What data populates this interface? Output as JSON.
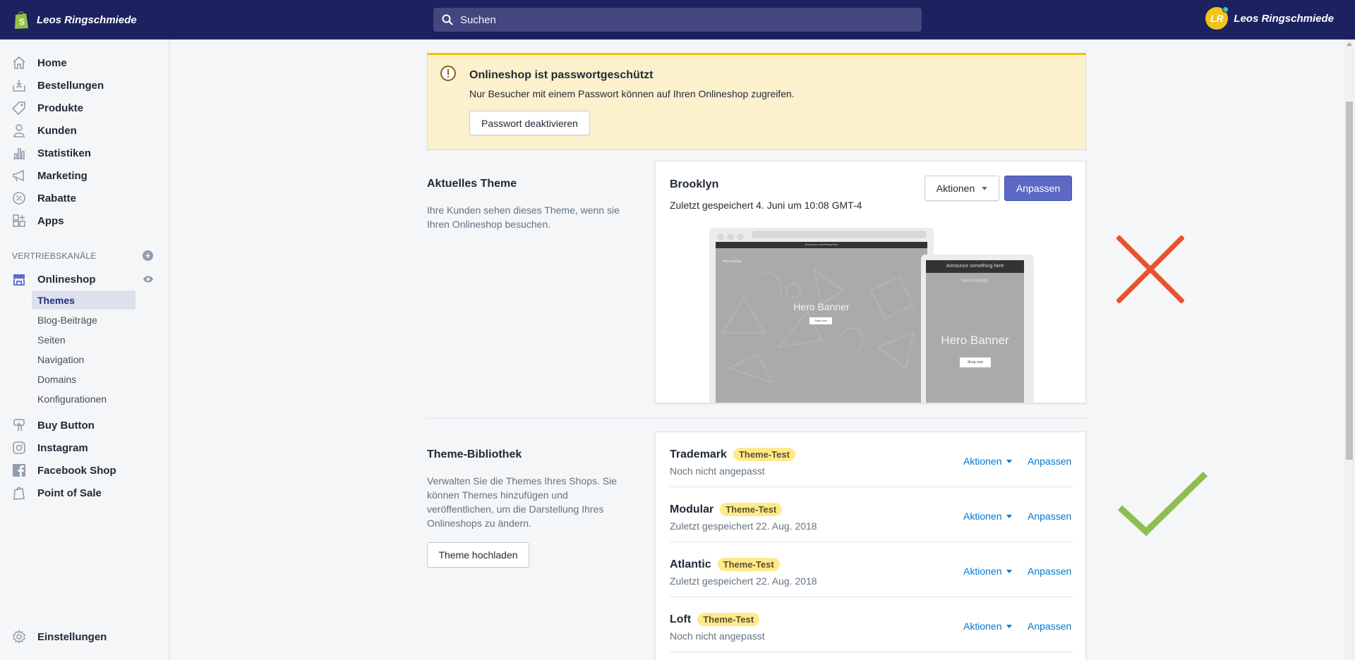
{
  "topbar": {
    "store_name": "Leos Ringschmiede",
    "search_placeholder": "Suchen",
    "avatar_initials": "LR",
    "account_name": "Leos Ringschmiede"
  },
  "sidebar": {
    "items": [
      {
        "label": "Home",
        "icon": "home-icon"
      },
      {
        "label": "Bestellungen",
        "icon": "orders-icon"
      },
      {
        "label": "Produkte",
        "icon": "tag-icon"
      },
      {
        "label": "Kunden",
        "icon": "person-icon"
      },
      {
        "label": "Statistiken",
        "icon": "bar-chart-icon"
      },
      {
        "label": "Marketing",
        "icon": "megaphone-icon"
      },
      {
        "label": "Rabatte",
        "icon": "discount-icon"
      },
      {
        "label": "Apps",
        "icon": "apps-icon"
      }
    ],
    "sales_channels_title": "VERTRIEBSKANÄLE",
    "online_store": "Onlineshop",
    "online_store_subitems": [
      "Themes",
      "Blog-Beiträge",
      "Seiten",
      "Navigation",
      "Domains",
      "Konfigurationen"
    ],
    "channels": [
      {
        "label": "Buy Button",
        "icon": "buy-button-icon"
      },
      {
        "label": "Instagram",
        "icon": "instagram-icon"
      },
      {
        "label": "Facebook Shop",
        "icon": "facebook-icon"
      },
      {
        "label": "Point of Sale",
        "icon": "pos-icon"
      }
    ],
    "settings": "Einstellungen"
  },
  "banner": {
    "title": "Onlineshop ist passwortgeschützt",
    "text": "Nur Besucher mit einem Passwort können auf Ihren Onlineshop zugreifen.",
    "button": "Passwort deaktivieren"
  },
  "current_theme": {
    "section_title": "Aktuelles Theme",
    "section_desc": "Ihre Kunden sehen dieses Theme, wenn sie Ihren Onlineshop besuchen.",
    "name": "Brooklyn",
    "saved": "Zuletzt gespeichert 4. Juni um 10:08 GMT-4",
    "actions_label": "Aktionen",
    "customize_label": "Anpassen",
    "preview": {
      "announce": "Announce something here",
      "store": "test-markep",
      "hero": "Hero Banner",
      "shop_now": "Shop now"
    }
  },
  "library": {
    "section_title": "Theme-Bibliothek",
    "section_desc": "Verwalten Sie die Themes Ihres Shops. Sie können Themes hinzufügen und veröffentlichen, um die Darstellung Ihres Onlineshops zu ändern.",
    "upload_button": "Theme hochladen",
    "actions_label": "Aktionen",
    "customize_label": "Anpassen",
    "themes": [
      {
        "name": "Trademark",
        "badge": "Theme-Test",
        "status": "Noch nicht angepasst"
      },
      {
        "name": "Modular",
        "badge": "Theme-Test",
        "status": "Zuletzt gespeichert 22. Aug. 2018"
      },
      {
        "name": "Atlantic",
        "badge": "Theme-Test",
        "status": "Zuletzt gespeichert 22. Aug. 2018"
      },
      {
        "name": "Loft",
        "badge": "Theme-Test",
        "status": "Noch nicht angepasst"
      }
    ]
  },
  "colors": {
    "topbar": "#1c2260",
    "primary": "#5c6ac4",
    "link": "#007ace",
    "cross": "#e8522e",
    "check": "#8cbf4f"
  }
}
